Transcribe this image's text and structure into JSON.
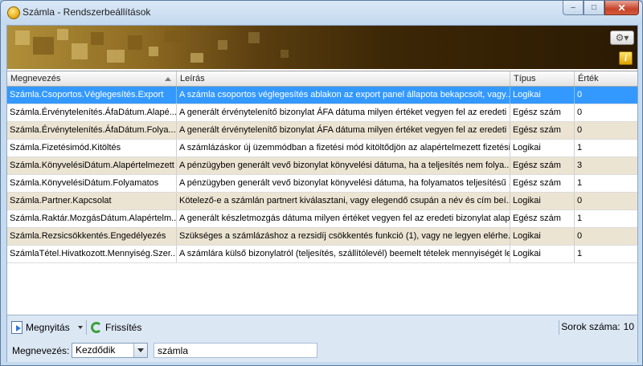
{
  "window": {
    "title": "Számla - Rendszerbeállítások",
    "buttons": {
      "minimize": "–",
      "maximize": "□",
      "close": "✕"
    }
  },
  "banner": {
    "gear_glyph": "⚙▾",
    "info_glyph": "i"
  },
  "table": {
    "columns": [
      "Megnevezés",
      "Leírás",
      "Típus",
      "Érték"
    ],
    "sort_column": "Megnevezés",
    "selected_row": 0,
    "rows": [
      {
        "name": "Számla.Csoportos.Véglegesítés.Export",
        "desc": "A számla csoportos véglegesítés ablakon az export panel állapota bekapcsolt, vagy...",
        "type": "Logikai",
        "value": "0"
      },
      {
        "name": "Számla.Érvénytelenítés.ÁfaDátum.Alapé...",
        "desc": "A generált érvénytelenítő bizonylat ÁFA dátuma milyen értéket vegyen fel az eredeti ...",
        "type": "Egész szám",
        "value": "0"
      },
      {
        "name": "Számla.Érvénytelenítés.ÁfaDátum.Folya...",
        "desc": "A generált érvénytelenítő bizonylat ÁFA dátuma milyen értéket vegyen fel az eredeti ...",
        "type": "Egész szám",
        "value": "0"
      },
      {
        "name": "Számla.Fizetésimód.Kitöltés",
        "desc": "A számlázáskor új üzemmódban a fizetési mód kitöltődjön az alapértelmezett fizetési ...",
        "type": "Logikai",
        "value": "1"
      },
      {
        "name": "Számla.KönyvelésiDátum.Alapértelmezett",
        "desc": "A pénzügyben generált vevő bizonylat könyvelési dátuma, ha a teljesítés nem folya...",
        "type": "Egész szám",
        "value": "3"
      },
      {
        "name": "Számla.KönyvelésiDátum.Folyamatos",
        "desc": "A pénzügyben generált vevő bizonylat könyvelési dátuma, ha folyamatos teljesítésű ...",
        "type": "Egész szám",
        "value": "1"
      },
      {
        "name": "Számla.Partner.Kapcsolat",
        "desc": "Kötelező-e a számlán partnert kiválasztani, vagy elegendő csupán a név és cím beí...",
        "type": "Logikai",
        "value": "0"
      },
      {
        "name": "Számla.Raktár.MozgásDátum.Alapértelm...",
        "desc": "A generált készletmozgás dátuma milyen értéket vegyen fel az eredeti bizonylat alapj...",
        "type": "Egész szám",
        "value": "1"
      },
      {
        "name": "Számla.Rezsicsökkentés.Engedélyezés",
        "desc": "Szükséges a számlázáshoz a rezsidíj csökkentés funkció (1), vagy ne legyen elérhe...",
        "type": "Logikai",
        "value": "0"
      },
      {
        "name": "SzámlaTétel.Hivatkozott.Mennyiség.Szer...",
        "desc": "A számlára külső bizonylatról (teljesítés, szállítólevél) beemelt tételek mennyiségét le...",
        "type": "Logikai",
        "value": "1"
      }
    ]
  },
  "toolbar": {
    "open_label": "Megnyitás",
    "refresh_label": "Frissítés",
    "row_count_label": "Sorok száma:",
    "row_count_value": "10"
  },
  "filter": {
    "label": "Megnevezés:",
    "mode_value": "Kezdődik",
    "search_value": "számla"
  },
  "colors": {
    "selection": "#3399ff",
    "alt_row": "#ece4d3",
    "banner_gold": "#b08f3a"
  }
}
